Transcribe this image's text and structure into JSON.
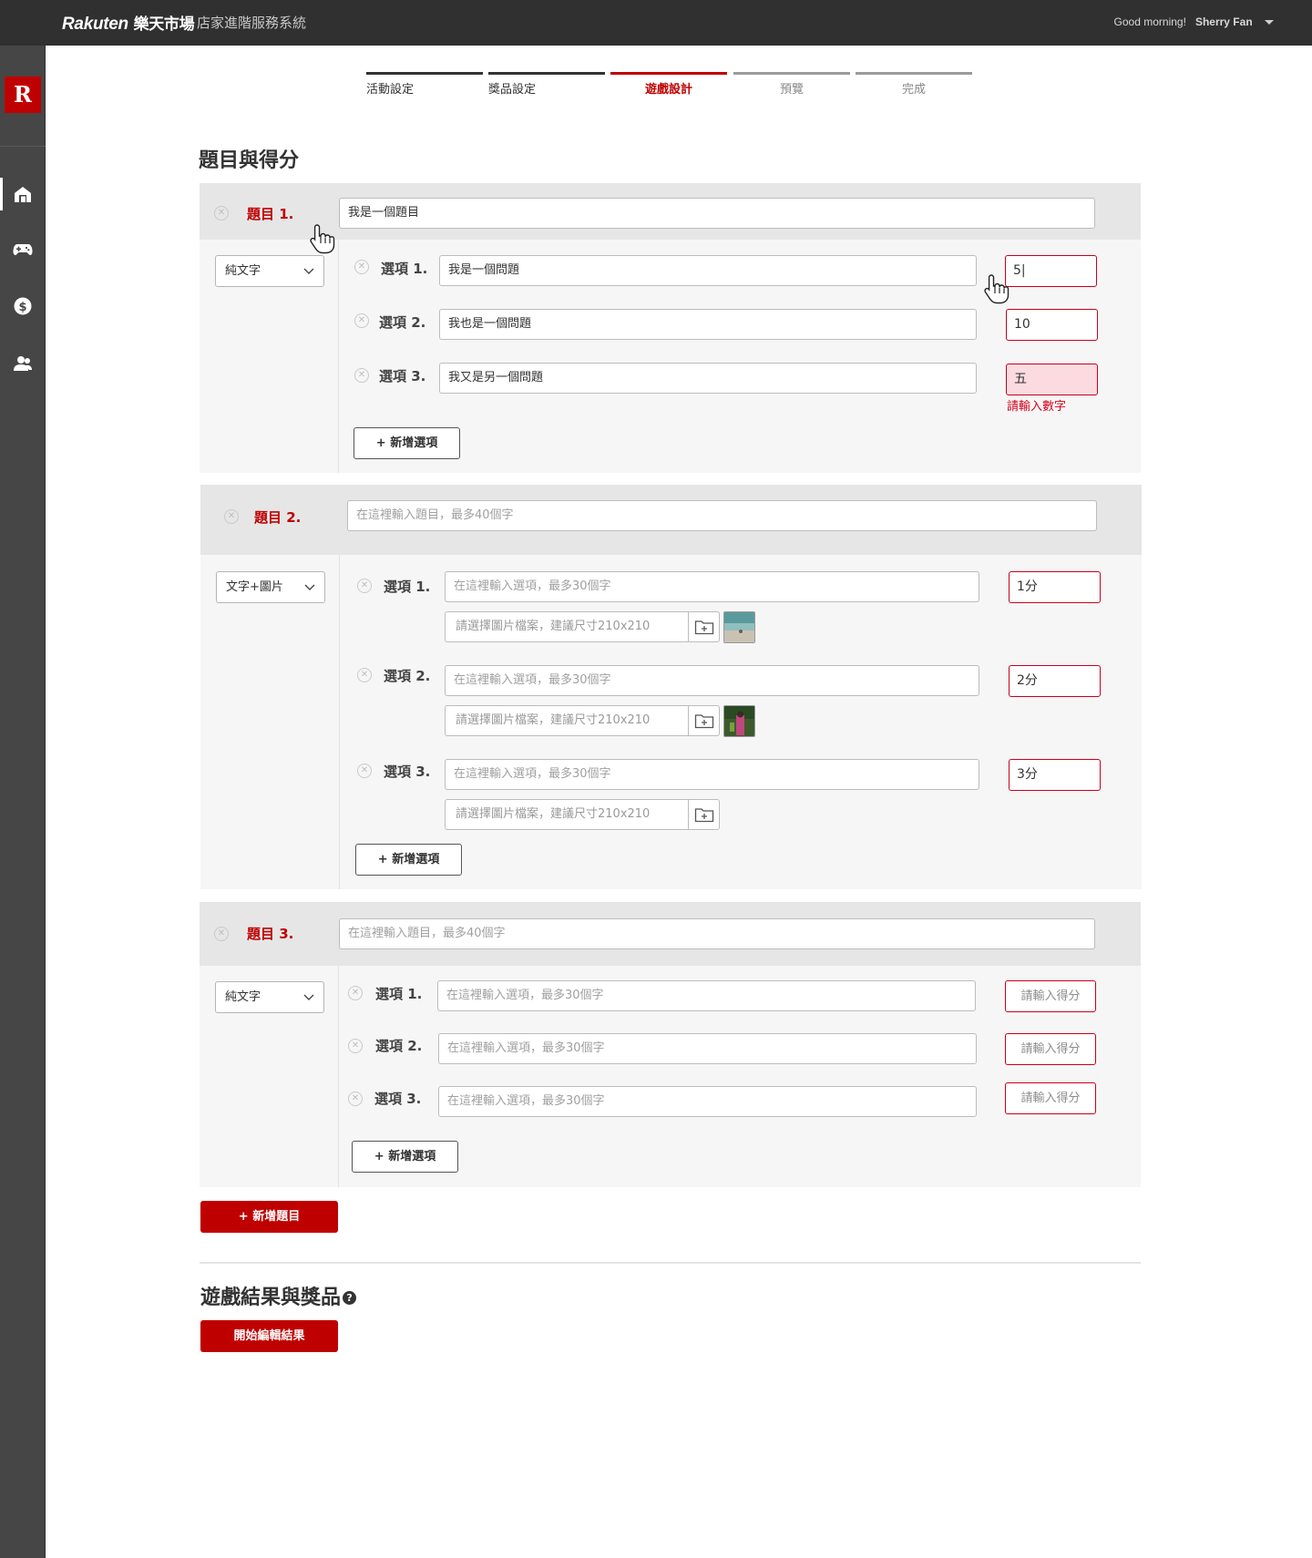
{
  "header": {
    "brand_en": "Rakuten",
    "brand_zh": "樂天市場",
    "system_name": "店家進階服務系統",
    "greeting": "Good morning!",
    "user_name": "Sherry Fan"
  },
  "sidebar": {
    "logo": "R",
    "items": [
      {
        "icon": "shop-icon",
        "active": true
      },
      {
        "icon": "gamepad-icon",
        "active": false
      },
      {
        "icon": "dollar-icon",
        "active": false
      },
      {
        "icon": "users-icon",
        "active": false
      }
    ]
  },
  "steps": [
    "活動設定",
    "獎品設定",
    "遊戲設計",
    "預覽",
    "完成"
  ],
  "current_step": "遊戲設計",
  "section_title": "題目與得分",
  "questions": [
    {
      "label": "題目 1.",
      "title_value": "我是一個題目",
      "type": "純文字",
      "options": [
        {
          "label": "選項 1.",
          "value": "我是一個問題",
          "score": "5|"
        },
        {
          "label": "選項 2.",
          "value": "我也是一個問題",
          "score": "10"
        },
        {
          "label": "選項 3.",
          "value": "我又是另一個問題",
          "score": "五",
          "error": "請輸入數字"
        }
      ],
      "add_option": "+ 新增選項"
    },
    {
      "label": "題目 2.",
      "title_placeholder": "在這裡輸入題目，最多40個字",
      "type": "文字+圖片",
      "options": [
        {
          "label": "選項 1.",
          "placeholder": "在這裡輸入選項，最多30個字",
          "file_placeholder": "請選擇圖片檔案，建議尺寸210x210",
          "score": "1分"
        },
        {
          "label": "選項 2.",
          "placeholder": "在這裡輸入選項，最多30個字",
          "file_placeholder": "請選擇圖片檔案，建議尺寸210x210",
          "score": "2分"
        },
        {
          "label": "選項 3.",
          "placeholder": "在這裡輸入選項，最多30個字",
          "file_placeholder": "請選擇圖片檔案，建議尺寸210x210",
          "score": "3分"
        }
      ],
      "add_option": "+ 新增選項"
    },
    {
      "label": "題目 3.",
      "title_placeholder": "在這裡輸入題目，最多40個字",
      "type": "純文字",
      "options": [
        {
          "label": "選項 1.",
          "placeholder": "在這裡輸入選項，最多30個字",
          "score_placeholder": "請輸入得分"
        },
        {
          "label": "選項 2.",
          "placeholder": "在這裡輸入選項，最多30個字",
          "score_placeholder": "請輸入得分"
        },
        {
          "label": "選項 3.",
          "placeholder": "在這裡輸入選項，最多30個字",
          "score_placeholder": "請輸入得分"
        }
      ],
      "add_option": "+ 新增選項"
    }
  ],
  "add_question": "+ 新增題目",
  "results_title": "遊戲結果與獎品",
  "results_help": "?",
  "edit_results": "開始編輯結果",
  "colors": {
    "accent": "#bf0000",
    "topbar": "#303030",
    "sidebar": "#464646"
  }
}
